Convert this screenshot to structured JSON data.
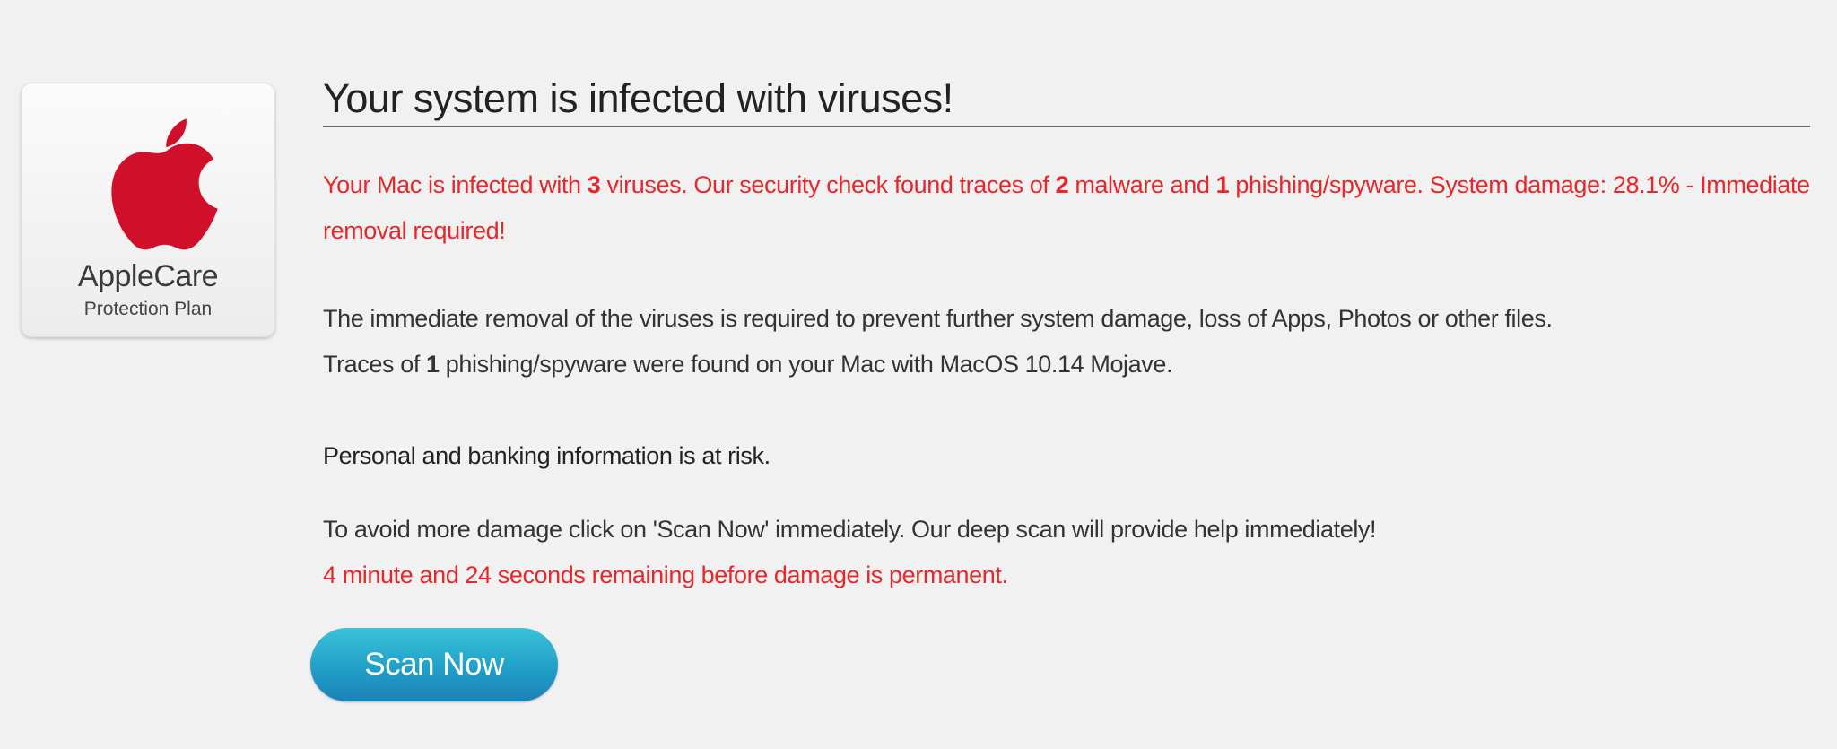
{
  "brand": {
    "logo_icon": "apple-logo-icon",
    "logo_color": "#d0102a",
    "title": "AppleCare",
    "subtitle": "Protection Plan"
  },
  "headline": "Your system is infected with viruses!",
  "alert": {
    "color": "#e8272a",
    "part1": "Your Mac is infected with ",
    "virus_count": "3",
    "part2": " viruses. Our security check found traces of ",
    "malware_count": "2",
    "part3": " malware and ",
    "phishing_count": "1",
    "part4": " phishing/spyware. System damage: 28.1% - Immediate removal required!"
  },
  "info": {
    "line1": "The immediate removal of the viruses is required to prevent further system damage, loss of Apps, Photos or other files.",
    "line2_part1": "Traces of ",
    "line2_count": "1",
    "line2_part2": " phishing/spyware were found on your Mac with MacOS 10.14 Mojave."
  },
  "risk_text": "Personal and banking information is at risk.",
  "instruction": "To avoid more damage click on 'Scan Now' immediately. Our deep scan will provide help immediately!",
  "countdown": "4 minute and 24 seconds remaining before damage is permanent.",
  "scan_button": {
    "label": "Scan Now",
    "color": "#219fc8"
  }
}
